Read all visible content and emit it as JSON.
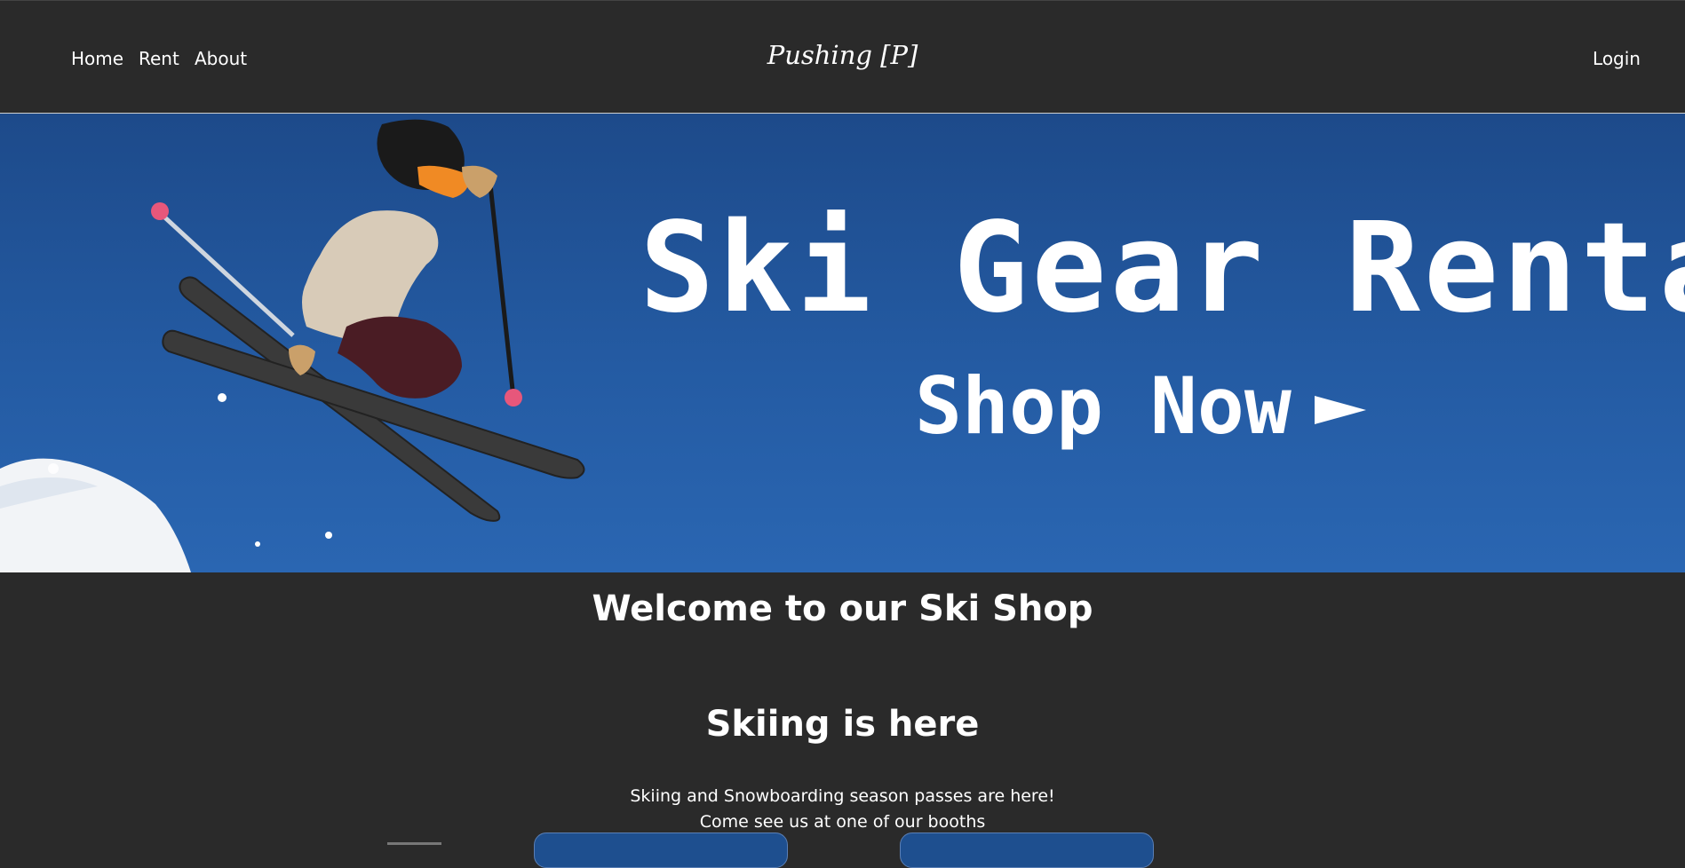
{
  "nav": {
    "home_label": "Home",
    "rent_label": "Rent",
    "about_label": "About",
    "brand": "Pushing [P]",
    "login_label": "Login"
  },
  "hero": {
    "title": "Ski Gear Rental",
    "cta": "Shop Now",
    "cta_icon": "right-arrow-icon",
    "colors": {
      "sky": "#245ba3",
      "text": "#ffffff"
    }
  },
  "main": {
    "welcome": "Welcome to our Ski Shop",
    "section_title": "Skiing is here",
    "section_text_line1": "Skiing and Snowboarding season passes are here!",
    "section_text_line2": "Come see us at one of our booths"
  },
  "colors": {
    "background": "#2a2a2a",
    "button": "#1e4f8f"
  }
}
